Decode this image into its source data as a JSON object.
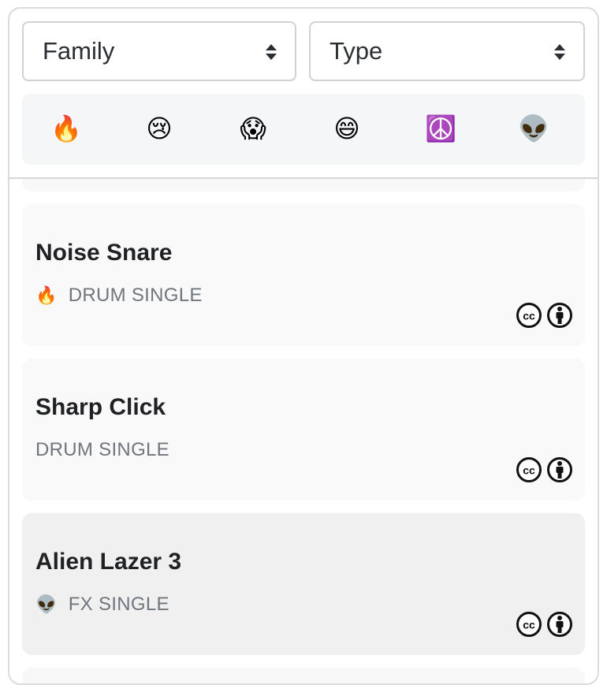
{
  "filters": {
    "family_label": "Family",
    "type_label": "Type"
  },
  "moods": [
    {
      "name": "fire",
      "glyph": "🔥"
    },
    {
      "name": "sad",
      "glyph": "😢"
    },
    {
      "name": "scared",
      "glyph": "😱"
    },
    {
      "name": "happy",
      "glyph": "😄"
    },
    {
      "name": "peace",
      "glyph": "☮️"
    },
    {
      "name": "alien",
      "glyph": "👽"
    }
  ],
  "sounds": [
    {
      "title": "Noise Snare",
      "mood_glyph": "🔥",
      "category": "DRUM SINGLE",
      "license_icons": [
        "cc-icon",
        "attribution-icon"
      ]
    },
    {
      "title": "Sharp Click",
      "mood_glyph": "",
      "category": "DRUM SINGLE",
      "license_icons": [
        "cc-icon",
        "attribution-icon"
      ]
    },
    {
      "title": "Alien Lazer 3",
      "mood_glyph": "👽",
      "category": "FX SINGLE",
      "license_icons": [
        "cc-icon",
        "attribution-icon"
      ]
    }
  ],
  "colors": {
    "card_bg": "#f9f9f9",
    "card_selected_bg": "#f0f0f0",
    "mood_bar_bg": "#f5f6f8",
    "meta_text": "#6f767d"
  }
}
